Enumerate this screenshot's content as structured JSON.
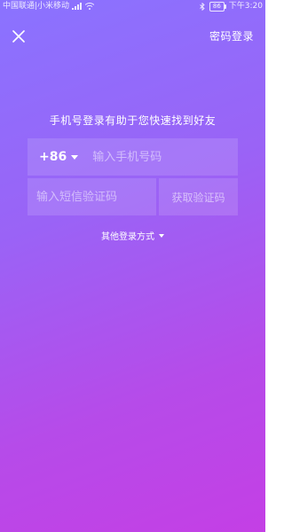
{
  "status_bar": {
    "carrier": "中国联通|小米移动",
    "battery": "86",
    "time": "下午3:20"
  },
  "header": {
    "close_icon": "close-icon",
    "password_login_label": "密码登录"
  },
  "prompt": "手机号登录有助于您快速找到好友",
  "phone": {
    "country_code": "+86",
    "placeholder": "输入手机号码",
    "value": ""
  },
  "code": {
    "placeholder": "输入短信验证码",
    "value": "",
    "get_code_label": "获取验证码"
  },
  "other_login_label": "其他登录方式",
  "colors": {
    "gradient_top": "#8a73ff",
    "gradient_bottom": "#c43fe5",
    "text": "#ffffff"
  }
}
